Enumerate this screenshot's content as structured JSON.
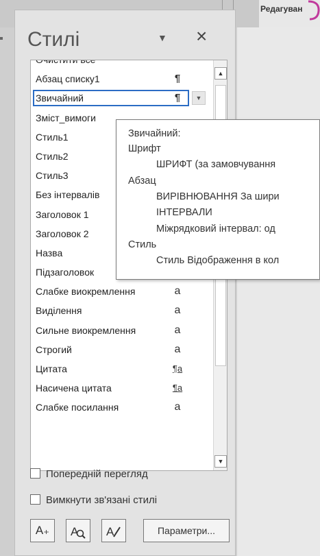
{
  "ribbon": {
    "edit_label": "Редагуван"
  },
  "pane": {
    "title": "Стилі",
    "dropdown_glyph": "▼",
    "close_glyph": "×",
    "styles": [
      {
        "name": "Очистити все",
        "glyph": ""
      },
      {
        "name": "Абзац списку1",
        "glyph": "¶"
      },
      {
        "name": "Звичайний",
        "glyph": "¶",
        "selected": true
      },
      {
        "name": "Зміст_вимоги",
        "glyph": ""
      },
      {
        "name": "Стиль1",
        "glyph": ""
      },
      {
        "name": "Стиль2",
        "glyph": ""
      },
      {
        "name": "Стиль3",
        "glyph": ""
      },
      {
        "name": "Без інтервалів",
        "glyph": ""
      },
      {
        "name": "Заголовок 1",
        "glyph": ""
      },
      {
        "name": "Заголовок 2",
        "glyph": ""
      },
      {
        "name": "Назва",
        "glyph": "¶"
      },
      {
        "name": "Підзаголовок",
        "glyph": "¶"
      },
      {
        "name": "Слабке виокремлення",
        "glyph": "a"
      },
      {
        "name": "Виділення",
        "glyph": "a"
      },
      {
        "name": "Сильне виокремлення",
        "glyph": "a"
      },
      {
        "name": "Строгий",
        "glyph": "a"
      },
      {
        "name": "Цитата",
        "glyph": "¶a"
      },
      {
        "name": "Насичена цитата",
        "glyph": "¶a"
      },
      {
        "name": "Слабке посилання",
        "glyph": "a"
      }
    ],
    "scroll_up_glyph": "▲",
    "scroll_down_glyph": "▼",
    "preview_label": "Попередній перегляд",
    "disable_linked_label": "Вимкнути зв'язані стилі",
    "new_style_glyph": "A₊",
    "inspect_glyph": "A",
    "manage_glyph": "A",
    "options_label": "Параметри..."
  },
  "tooltip": {
    "heading": "Звичайний:",
    "font_label": "Шрифт",
    "font_value": "ШРИФТ  (за замовчування",
    "paragraph_label": "Абзац",
    "alignment_value": "ВИРІВНЮВАННЯ  За шири",
    "intervals_value": "ІНТЕРВАЛИ",
    "line_spacing_value": "Міжрядковий інтервал:  од",
    "style_label": "Стиль",
    "style_value": "Стиль Відображення в кол"
  },
  "colors": {
    "selection_border": "#2b6cc4",
    "accent": "#c0399c"
  }
}
